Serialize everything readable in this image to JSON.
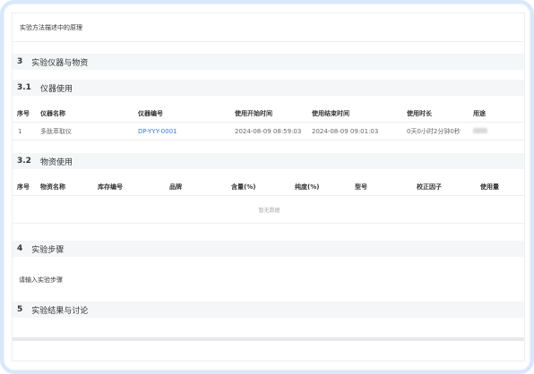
{
  "method_text": "实验方法描述中的原理",
  "sections": {
    "s3": {
      "num": "3",
      "title": "实验仪器与物资"
    },
    "s31": {
      "num": "3.1",
      "title": "仪器使用"
    },
    "s32": {
      "num": "3.2",
      "title": "物资使用"
    },
    "s4": {
      "num": "4",
      "title": "实验步骤"
    },
    "s5": {
      "num": "5",
      "title": "实验结果与讨论"
    }
  },
  "instruments": {
    "columns": [
      "序号",
      "仪器名称",
      "仪器编号",
      "使用开始时间",
      "使用结束时间",
      "使用时长",
      "用途"
    ],
    "rows": [
      {
        "index": "1",
        "name": "多肽萃取仪",
        "code": "DP-YYY-0001",
        "start": "2024-08-09 08:59:03",
        "end": "2024-08-09 09:01:03",
        "duration": "0天0小时2分钟0秒"
      }
    ]
  },
  "materials": {
    "columns": [
      "序号",
      "物资名称",
      "库存编号",
      "品牌",
      "含量(%)",
      "纯度(%)",
      "型号",
      "校正因子",
      "使用量"
    ],
    "empty_text": "暂无数据"
  },
  "steps_placeholder": "请输入实验步骤"
}
